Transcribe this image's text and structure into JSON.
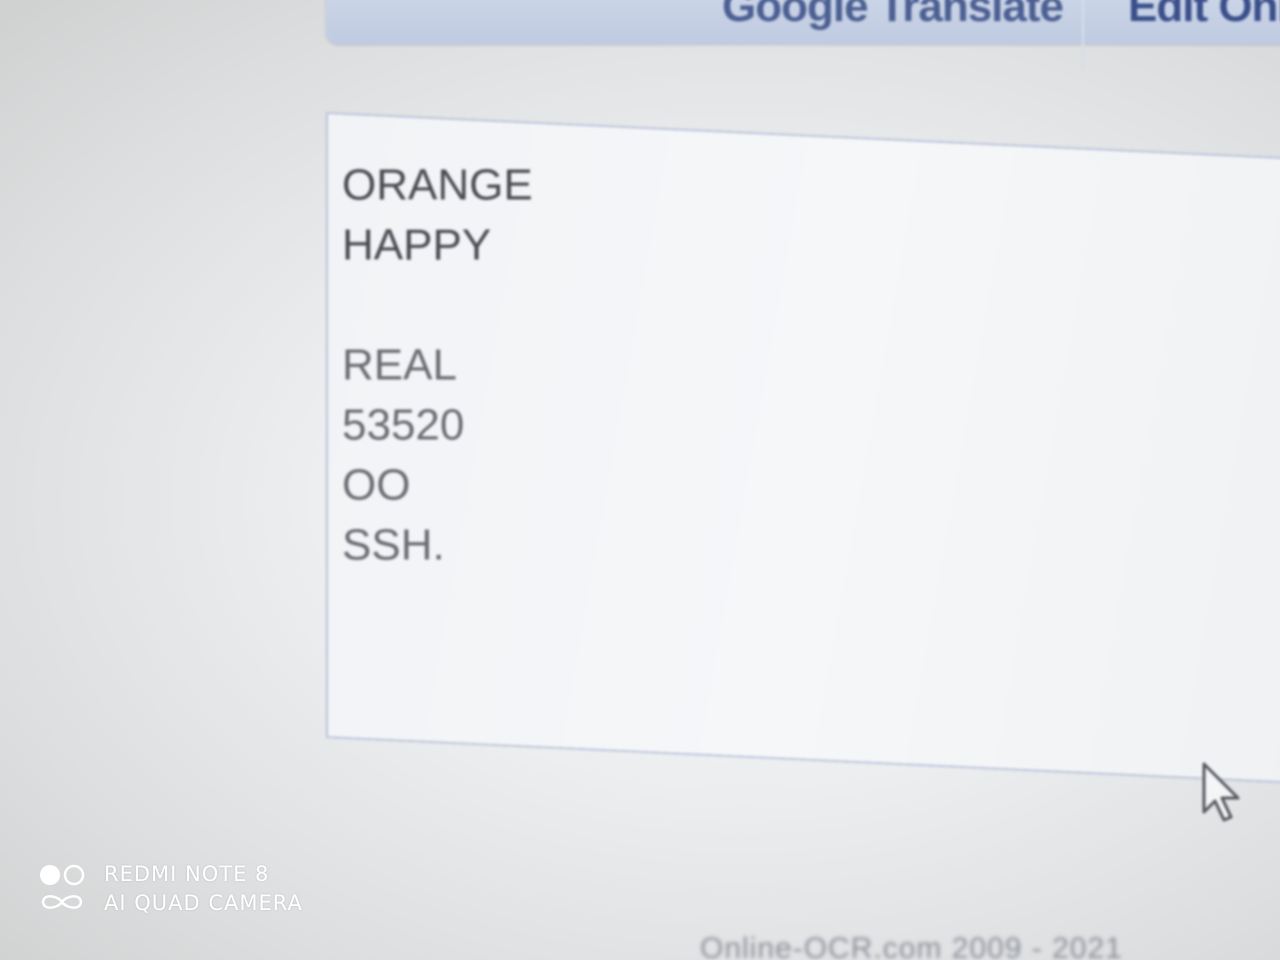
{
  "toolbar": {
    "translate_label": "Google Translate",
    "edit_label": "Edit Onli"
  },
  "textarea": {
    "lines": [
      "ORANGE",
      "HAPPY",
      "",
      "REAL",
      "53520",
      "OO",
      "SSH."
    ]
  },
  "footer": {
    "copyright": "Online-OCR.com 2009 - 2021"
  },
  "camera_watermark": {
    "model": "REDMI NOTE 8",
    "camera": "AI QUAD CAMERA"
  },
  "icons": {
    "cursor": "mouse-pointer-icon",
    "camera_logo": "quad-camera-logo-icon"
  },
  "colors": {
    "toolbar_bg": "#c4cfe4",
    "toolbar_text": "#3a4f8a",
    "textarea_border": "#b8c2d8",
    "text": "#4a4a52"
  }
}
